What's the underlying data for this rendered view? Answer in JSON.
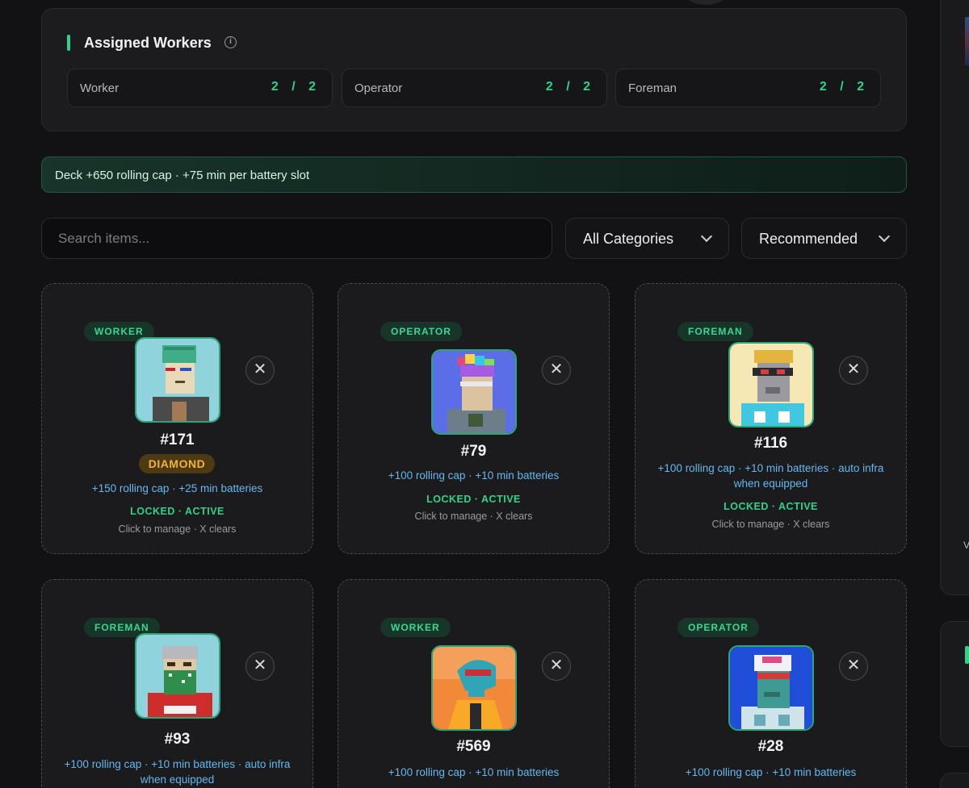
{
  "assigned": {
    "title": "Assigned Workers",
    "roles": [
      {
        "name": "Worker",
        "count": "2 / 2"
      },
      {
        "name": "Operator",
        "count": "2 / 2"
      },
      {
        "name": "Foreman",
        "count": "2 / 2"
      }
    ]
  },
  "banner": {
    "text": "Deck +650 rolling cap · +75 min per battery slot"
  },
  "search": {
    "placeholder": "Search items..."
  },
  "filters": {
    "category": "All Categories",
    "sort": "Recommended"
  },
  "colors": {
    "accent": "#2fd38a",
    "bonus": "#64b8ef",
    "diamond": "#f1b33c"
  },
  "cards": [
    {
      "role": "WORKER",
      "id": "#171",
      "rarity": "DIAMOND",
      "bonus": "+150 rolling cap · +25 min batteries",
      "status": "LOCKED · ACTIVE",
      "hint": "Click to manage · X clears"
    },
    {
      "role": "OPERATOR",
      "id": "#79",
      "bonus": "+100 rolling cap · +10 min batteries",
      "status": "LOCKED · ACTIVE",
      "hint": "Click to manage · X clears"
    },
    {
      "role": "FOREMAN",
      "id": "#116",
      "bonus": "+100 rolling cap · +10 min batteries · auto infra when equipped",
      "status": "LOCKED · ACTIVE",
      "hint": "Click to manage · X clears"
    },
    {
      "role": "FOREMAN",
      "id": "#93",
      "bonus": "+100 rolling cap · +10 min batteries · auto infra when equipped"
    },
    {
      "role": "WORKER",
      "id": "#569",
      "bonus": "+100 rolling cap · +10 min batteries"
    },
    {
      "role": "OPERATOR",
      "id": "#28",
      "bonus": "+100 rolling cap · +10 min batteries"
    }
  ],
  "right_column": {
    "partial_text": "V"
  }
}
